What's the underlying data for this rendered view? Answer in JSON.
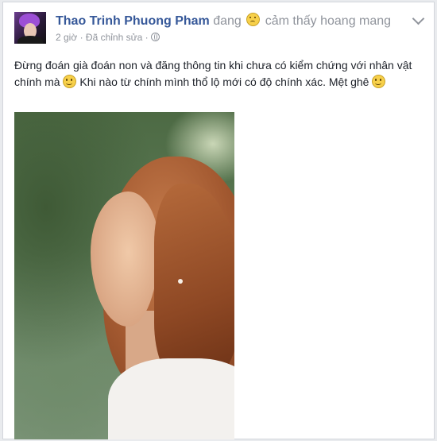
{
  "post": {
    "author_name": "Thao Trinh Phuong Pham",
    "feeling_prefix": "đang",
    "feeling_text": "cảm thấy hoang mang",
    "time": "2 giờ",
    "separator": "·",
    "edited": "Đã chỉnh sửa",
    "text_part1": "Đừng đoán già đoán non và đăng thông tin khi chưa có kiểm chứng với nhân vật chính mà",
    "text_part2": "Khi nào từ chính mình thổ lộ mới có độ chính xác. Mệt ghê"
  },
  "icons": {
    "feeling": "frowning-face-icon",
    "privacy": "globe-icon",
    "menu": "chevron-down-icon",
    "emoticon": "smile-icon"
  },
  "colors": {
    "name": "#365899",
    "meta": "#90949c",
    "text": "#1d2129",
    "background": "#e9ebee"
  }
}
